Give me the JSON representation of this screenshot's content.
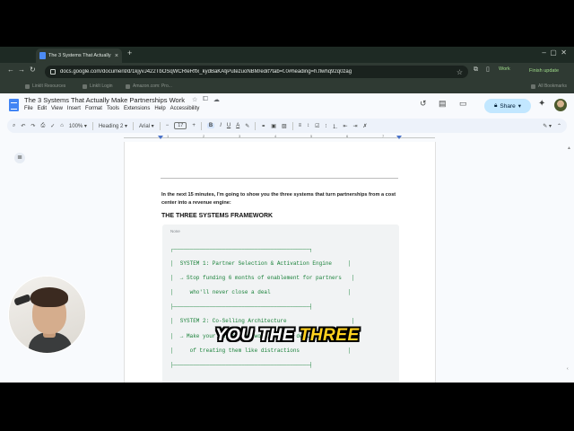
{
  "browser": {
    "tab_title": "The 3 Systems That Actually",
    "tab_close_icon": "×",
    "new_tab_icon": "+",
    "url": "docs.google.com/document/d/1kjyvJ422TbOSqWCRleRffx_kydBaKAtjPutezuoNBM/edit?tab=t.0#heading=h.flwhq92q0zag",
    "profile_label": "Work",
    "finish_update_label": "Finish update",
    "bookmarks": [
      "LinkIt Resources",
      "LinkIt Login",
      "Amazon.com: Pro..."
    ],
    "all_bookmarks_label": "All Bookmarks"
  },
  "docs": {
    "title": "The 3 Systems That Actually Make Partnerships Work",
    "menu": [
      "File",
      "Edit",
      "View",
      "Insert",
      "Format",
      "Tools",
      "Extensions",
      "Help",
      "Accessibility"
    ],
    "share_label": "Share"
  },
  "toolbar": {
    "zoom": "100%",
    "style": "Heading 2",
    "font": "Arial",
    "font_size": "17",
    "bold": "B",
    "italic": "I",
    "underline": "U",
    "text_color": "A"
  },
  "ruler_numbers": [
    "1",
    "2",
    "3",
    "4",
    "5",
    "6",
    "7"
  ],
  "document": {
    "intro": "In the next 15 minutes, I'm going to show you the three systems that turn partnerships from a cost center into a revenue engine:",
    "heading": "THE THREE SYSTEMS FRAMEWORK",
    "code_label": "None",
    "code_lines": [
      "┌──────────────────────────────────────────┐",
      "│  SYSTEM 1: Partner Selection & Activation Engine     │",
      "│  → Stop funding 6 months of enablement for partners   │",
      "│     who'll never close a deal                        │",
      "├──────────────────────────────────────────┤",
      "│  SYSTEM 2: Co-Selling Architecture                    │",
      "│  → Make your sales team work partner deals instead    │",
      "│     of treating them like distractions               │",
      "├──────────────────────────────────────────┤"
    ]
  },
  "caption": {
    "white_words": "YOU THE",
    "yellow_word": "THREE"
  },
  "colors": {
    "share_bg": "#c2e7ff",
    "code_text": "#188038",
    "caption_highlight": "#ffd21f",
    "browser_chrome": "#2f3a33"
  }
}
